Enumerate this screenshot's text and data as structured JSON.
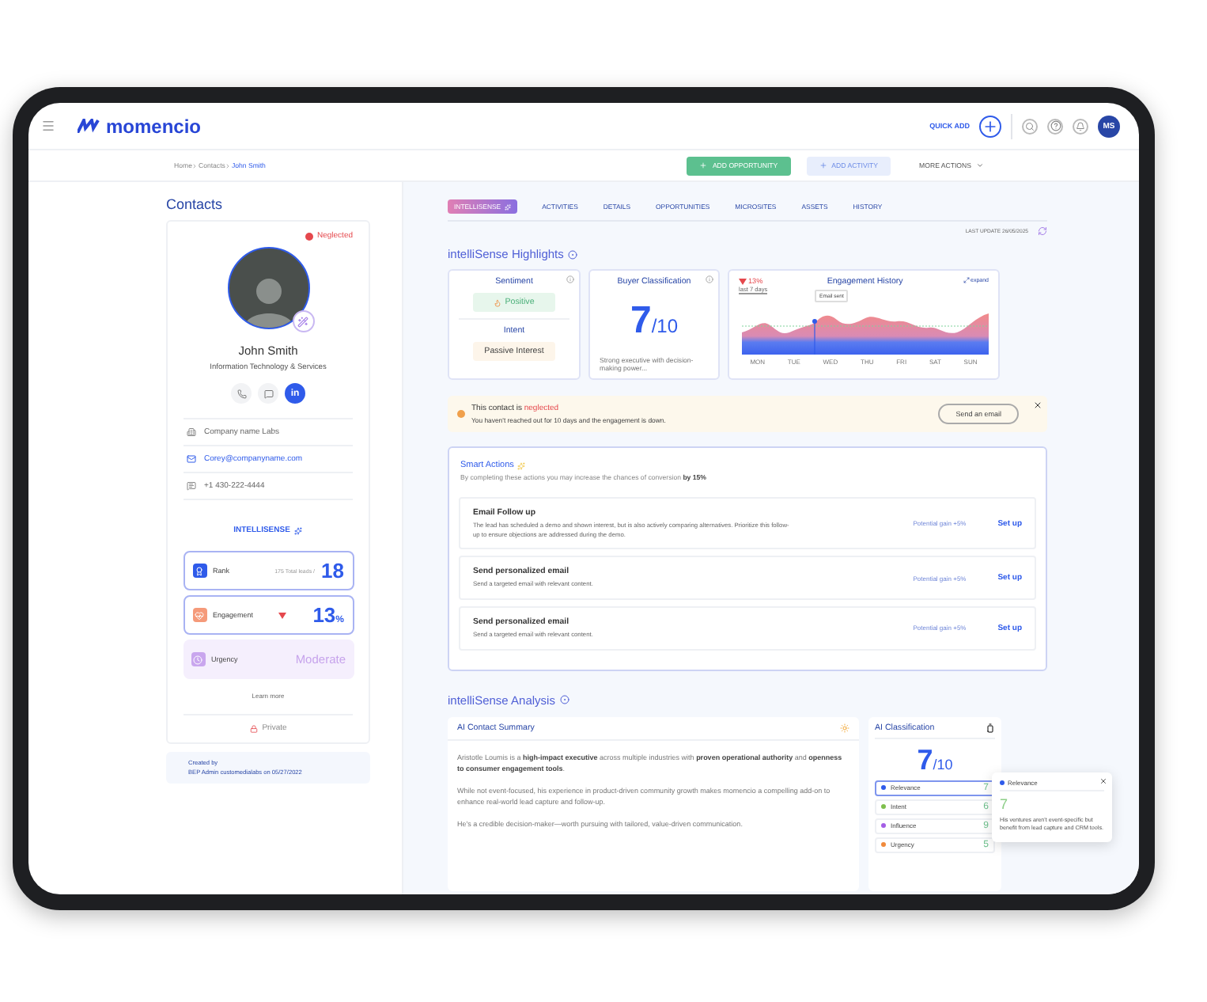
{
  "app": {
    "logo": "momencio",
    "quick_add": "QUICK ADD",
    "avatar": "MS"
  },
  "breadcrumb": [
    {
      "label": "Home",
      "selected": false
    },
    {
      "label": "Contacts",
      "selected": false
    },
    {
      "label": "John Smith",
      "selected": true
    }
  ],
  "actions": [
    {
      "label": "ADD OPPORTUNITY",
      "kind": "primary"
    },
    {
      "label": "ADD ACTIVITY",
      "kind": "secondary"
    },
    {
      "label": "MORE ACTIONS",
      "kind": "menu"
    }
  ],
  "contact": {
    "page_title": "Contacts",
    "status": "Neglected",
    "name": "John Smith",
    "industry": "Information Technology & Services",
    "linkedin": "in",
    "details": [
      {
        "kind": "company",
        "text": "Company name Labs"
      },
      {
        "kind": "email",
        "text": "Corey@companyname.com"
      },
      {
        "kind": "phone",
        "text": "+1 430-222-4444"
      }
    ],
    "intellisense_title": "INTELLISENSE",
    "metrics": [
      {
        "kind": "rank",
        "label": "Rank",
        "note": "175 Total leads /",
        "value": "18"
      },
      {
        "kind": "engagement",
        "label": "Engagement",
        "value": "13",
        "unit": "%"
      },
      {
        "kind": "urgency",
        "label": "Urgency",
        "value": "Moderate"
      }
    ],
    "learn_more": "Learn more",
    "privacy": "Private",
    "created_label": "Created by",
    "created_text": "BEP Admin customedialabs on 05/27/2022"
  },
  "tabs": [
    {
      "label": "INTELLISENSE",
      "selected": true
    },
    {
      "label": "ACTIVITIES",
      "selected": false
    },
    {
      "label": "DETAILS",
      "selected": false
    },
    {
      "label": "OPPORTUNITIES",
      "selected": false
    },
    {
      "label": "MICROSITES",
      "selected": false
    },
    {
      "label": "ASSETS",
      "selected": false
    },
    {
      "label": "HISTORY",
      "selected": false
    }
  ],
  "last_update": "LAST UPDATE 26/05/2025",
  "highlights": {
    "title": "intelliSense Highlights",
    "sentiment": {
      "title": "Sentiment",
      "value": "Positive",
      "intent_label": "Intent",
      "intent": "Passive Interest"
    },
    "buyer": {
      "title": "Buyer Classification",
      "score": "7",
      "scale": "/10",
      "note": "Strong executive with decision-making power..."
    },
    "engagement": {
      "change": "13%",
      "period": "last 7 days",
      "title": "Engagement History",
      "expand": "expand",
      "marker": "Email sent",
      "days": [
        "MON",
        "TUE",
        "WED",
        "THU",
        "FRI",
        "SAT",
        "SUN"
      ]
    }
  },
  "alert": {
    "title": "This contact is",
    "highlight": "neglected",
    "message": "You haven't reached out for 10 days and the engagement is down.",
    "button": "Send an email"
  },
  "smart_actions": {
    "title": "Smart Actions",
    "subtitle": "By completing these actions you may increase the chances of conversion **by 15%**",
    "items": [
      {
        "title": "Email Follow up",
        "description": "The lead has scheduled a demo and shown interest, but is also actively comparing alternatives. Prioritize this follow-up to ensure objections are addressed during the demo.",
        "gain": "Potential gain +5%",
        "action": "Set up"
      },
      {
        "title": "Send personalized email",
        "description": "Send a targeted email with relevant content.",
        "gain": "Potential gain +5%",
        "action": "Set up"
      },
      {
        "title": "Send personalized email",
        "description": "Send a targeted email with relevant content.",
        "gain": "Potential gain +5%",
        "action": "Set up"
      }
    ]
  },
  "analysis": {
    "title": "intelliSense Analysis",
    "summary": {
      "title": "AI Contact Summary",
      "paragraphs": [
        "Aristotle Loumis is a **high-impact executive** across multiple industries with **proven operational authority** and **openness to consumer engagement tools**.",
        "While not event-focused, his experience in product-driven community growth makes momencio a compelling add-on to enhance real-world lead capture and follow-up.",
        "He's a credible decision-maker—worth pursuing with tailored, value-driven communication."
      ]
    },
    "classification": {
      "title": "AI Classification",
      "score": "7",
      "scale": "/10",
      "items": [
        {
          "label": "Relevance",
          "value": "7",
          "color": "#2f5bea",
          "selected": true
        },
        {
          "label": "Intent",
          "value": "6",
          "color": "#7fbf4d",
          "selected": false
        },
        {
          "label": "Influence",
          "value": "9",
          "color": "#a45ee5",
          "selected": false
        },
        {
          "label": "Urgency",
          "value": "5",
          "color": "#f08a3c",
          "selected": false
        }
      ]
    },
    "popover": {
      "label": "Relevance",
      "value": "7",
      "text": "His ventures aren't event-specific but benefit from lead capture and CRM tools."
    }
  }
}
